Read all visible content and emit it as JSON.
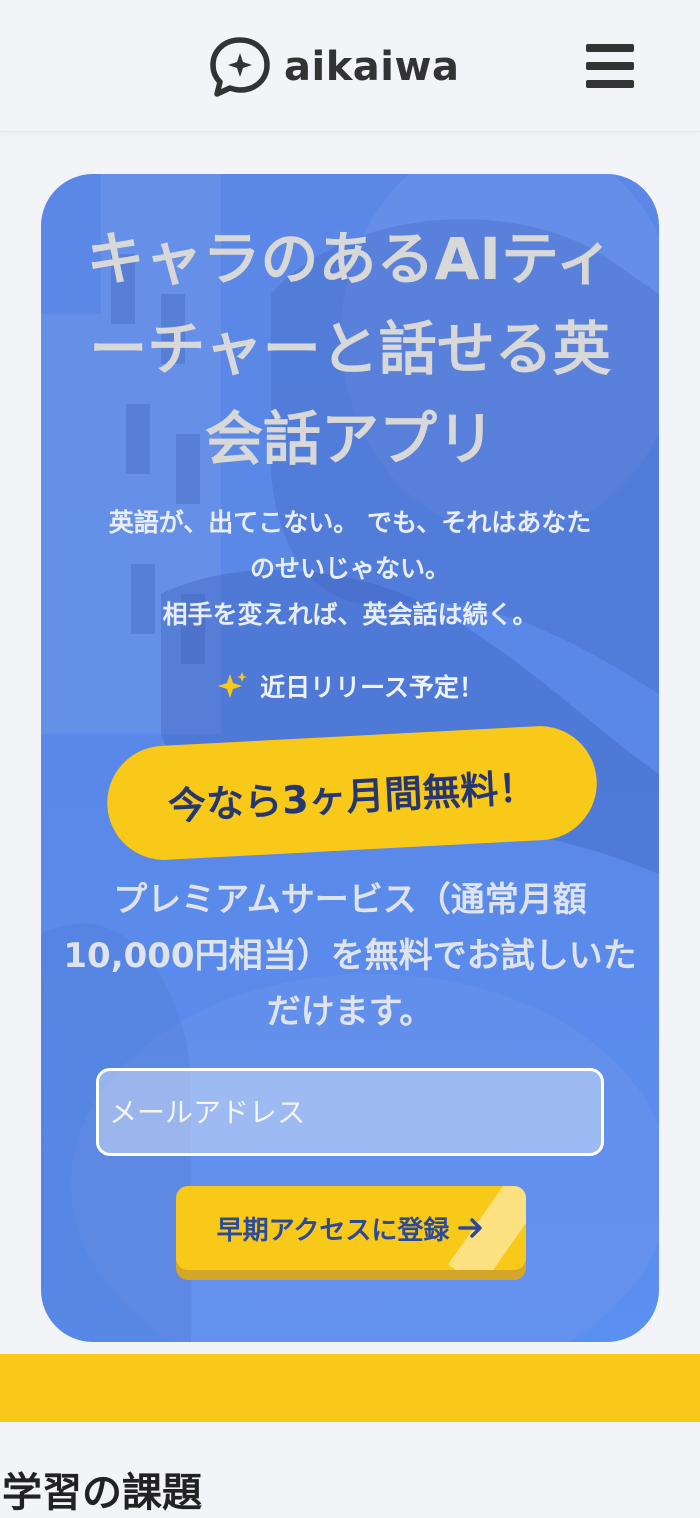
{
  "header": {
    "logo_text": "aikaiwa"
  },
  "hero": {
    "title": "キャラのあるAIティーチャーと話せる英会話アプリ",
    "subtitle_lines": [
      "英語が、出てこない。 でも、それはあなた",
      "のせいじゃない。",
      "相手を変えれば、英会話は続く。"
    ],
    "release_text": "近日リリース予定！",
    "free_banner": "今なら3ヶ月間無料！",
    "description": "プレミアムサービス（通常月額10,000円相当）を無料でお試しいただけます。",
    "email_placeholder": "メールアドレス",
    "cta_label": "早期アクセスに登録"
  },
  "section": {
    "title": "学習の課題"
  },
  "colors": {
    "accent_yellow": "#f9c91a",
    "hero_blue": "#5b88e8",
    "cta_text_navy": "#2d4a97",
    "page_background": "#f3f4f8"
  },
  "icons": {
    "logo": "speech-bubble-sparkle-icon",
    "menu": "hamburger-menu-icon",
    "release": "sparkle-icon",
    "cta": "arrow-right-icon"
  }
}
